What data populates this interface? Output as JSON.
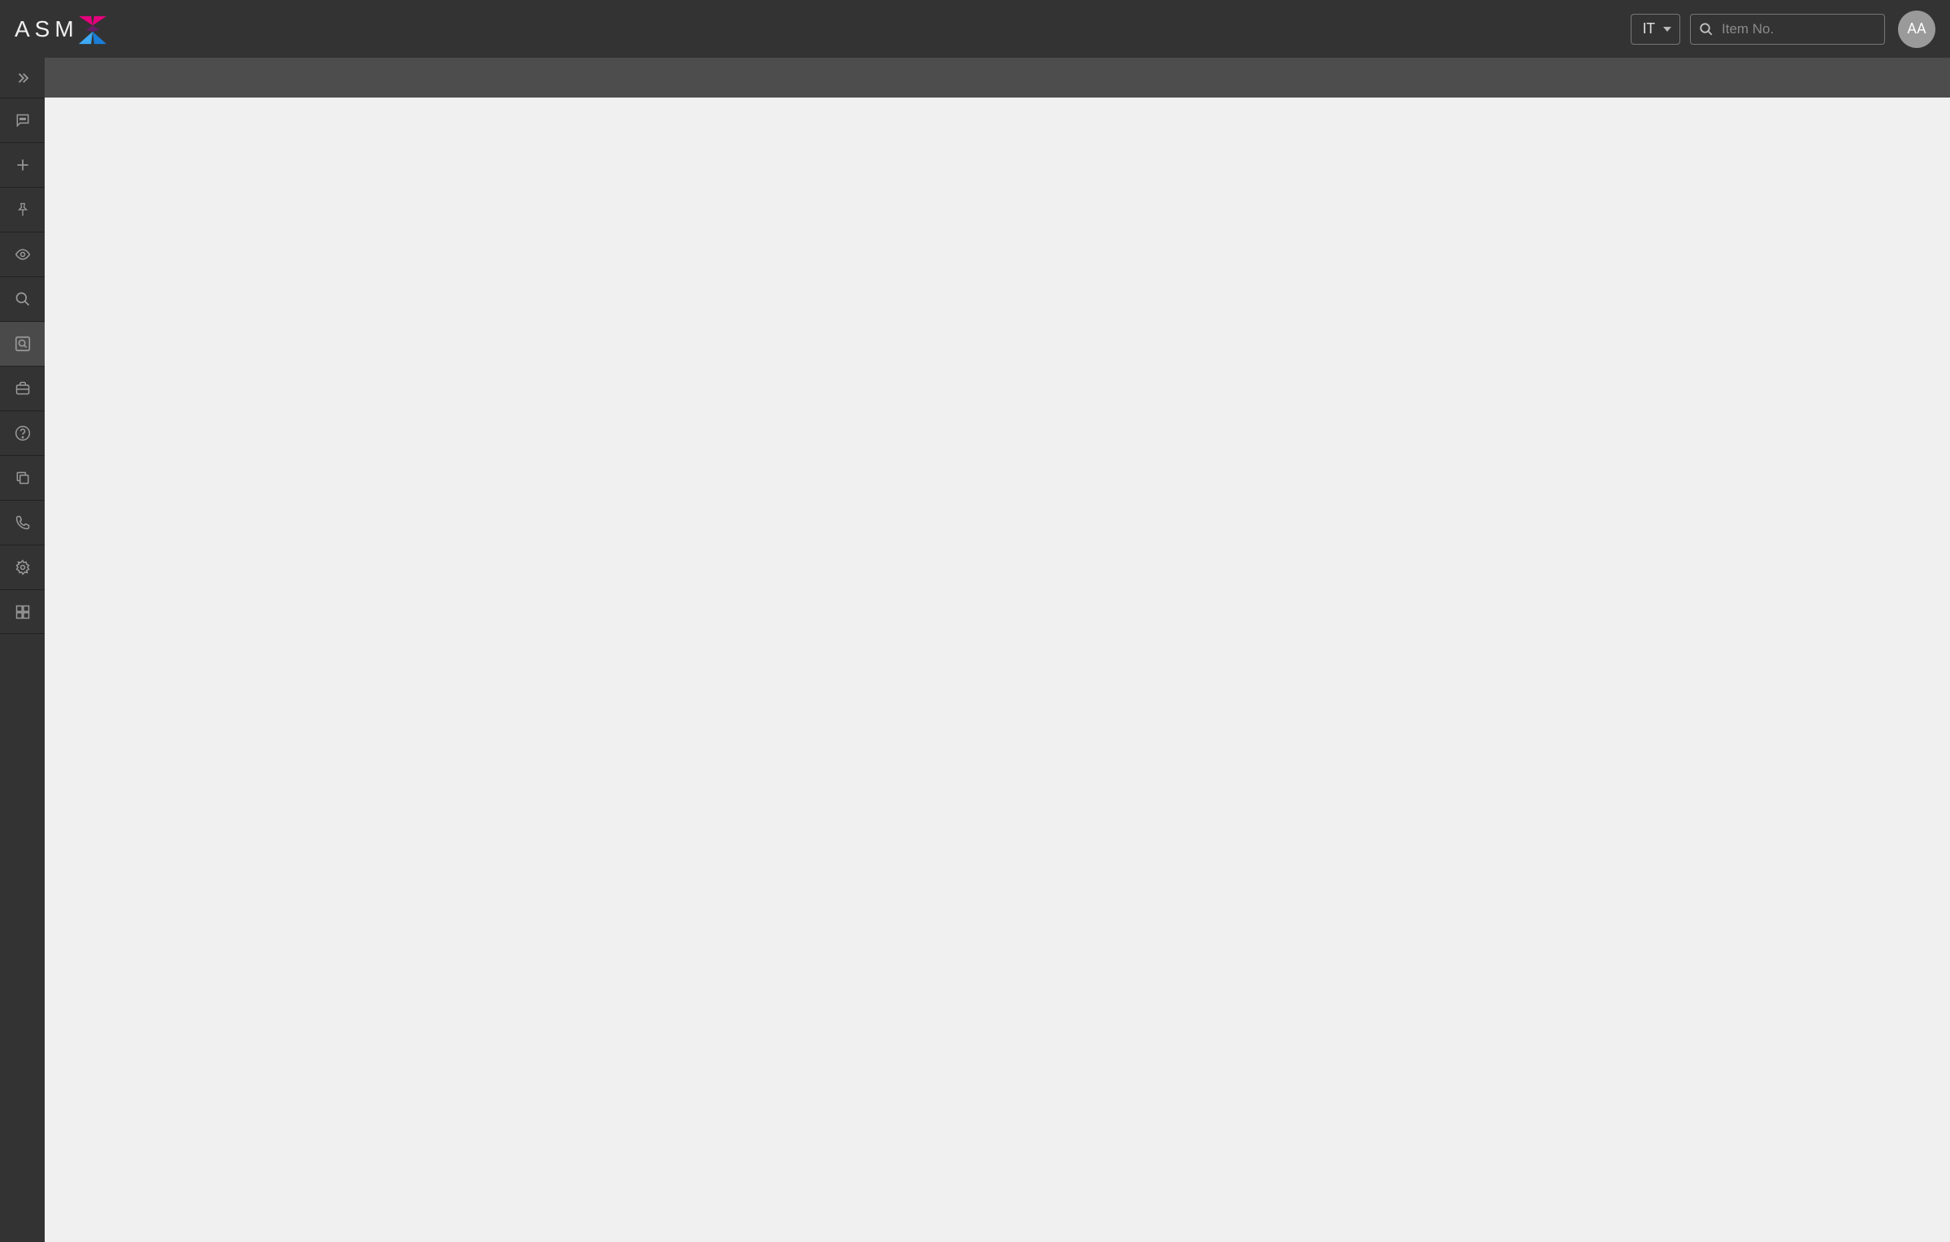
{
  "header": {
    "logo_text": "ASM",
    "lang_label": "IT",
    "search_placeholder": "Item No.",
    "avatar_initials": "AA"
  },
  "sidebar": {
    "items": [
      {
        "id": "expand",
        "icon": "chevron-double-right-icon",
        "active": false
      },
      {
        "id": "chat",
        "icon": "chat-icon",
        "active": false
      },
      {
        "id": "add",
        "icon": "plus-icon",
        "active": false
      },
      {
        "id": "pin",
        "icon": "pin-icon",
        "active": false
      },
      {
        "id": "view",
        "icon": "eye-icon",
        "active": false
      },
      {
        "id": "search",
        "icon": "search-icon",
        "active": false
      },
      {
        "id": "searchdoc",
        "icon": "search-doc-icon",
        "active": true
      },
      {
        "id": "briefcase",
        "icon": "briefcase-icon",
        "active": false
      },
      {
        "id": "help",
        "icon": "help-icon",
        "active": false
      },
      {
        "id": "copy",
        "icon": "copy-icon",
        "active": false
      },
      {
        "id": "phone",
        "icon": "phone-icon",
        "active": false
      },
      {
        "id": "settings",
        "icon": "gear-icon",
        "active": false
      },
      {
        "id": "apps",
        "icon": "grid-icon",
        "active": false
      }
    ]
  }
}
